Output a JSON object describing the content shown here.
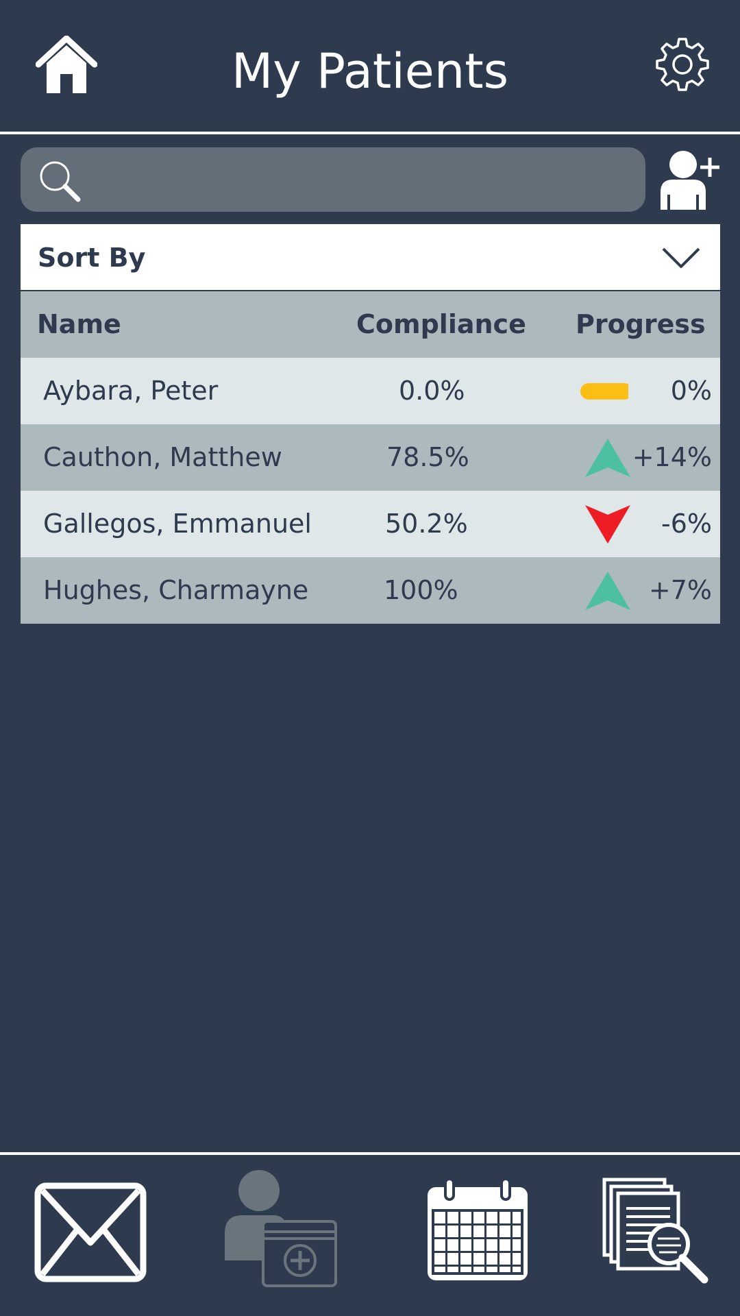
{
  "header": {
    "title": "My Patients",
    "home_icon": "home-icon",
    "settings_icon": "gear-icon"
  },
  "search": {
    "placeholder": "",
    "value": "",
    "icon": "search-icon",
    "add_icon": "add-user-icon"
  },
  "sort": {
    "label": "Sort By",
    "icon": "chevron-down-icon"
  },
  "table": {
    "columns": [
      "Name",
      "Compliance",
      "Progress"
    ],
    "rows": [
      {
        "name": "Aybara, Peter",
        "compliance": "0.0%",
        "trend": "neutral",
        "delta": "0%"
      },
      {
        "name": "Cauthon, Matthew",
        "compliance": "78.5%",
        "trend": "up",
        "delta": "+14%"
      },
      {
        "name": "Gallegos, Emmanuel",
        "compliance": "50.2%",
        "trend": "down",
        "delta": "-6%"
      },
      {
        "name": "Hughes, Charmayne",
        "compliance": "100%",
        "trend": "up",
        "delta": "+7%"
      }
    ]
  },
  "colors": {
    "background": "#2e3a4e",
    "up": "#4dbfa3",
    "down": "#ee1c24",
    "neutral": "#fbbe14"
  },
  "bottom_nav": {
    "items": [
      {
        "icon": "mail-icon"
      },
      {
        "icon": "patient-records-icon"
      },
      {
        "icon": "calendar-icon"
      },
      {
        "icon": "document-search-icon"
      }
    ]
  }
}
